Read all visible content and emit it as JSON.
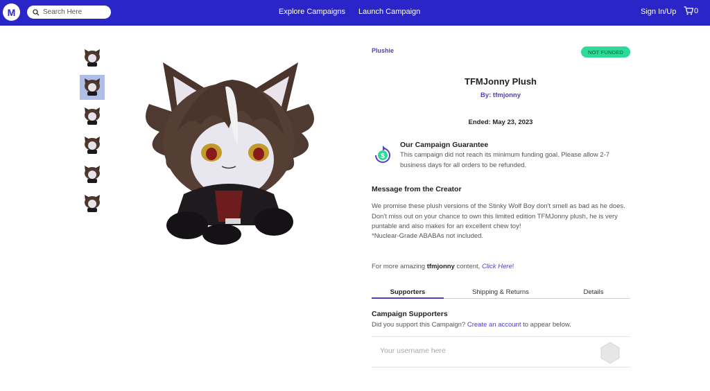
{
  "nav": {
    "logo_letter": "M",
    "search_placeholder": "Search Here",
    "explore": "Explore Campaigns",
    "launch": "Launch Campaign",
    "signin": "Sign In/Up",
    "cart_count": "0"
  },
  "product": {
    "category": "Plushie",
    "status": "NOT FUNDED",
    "title": "TFMJonny Plush",
    "by": "By: tfmjonny",
    "ended": "Ended: May 23, 2023"
  },
  "guarantee": {
    "title": "Our Campaign Guarantee",
    "text": "This campaign did not reach its minimum funding goal. Please allow 2-7 business days for all orders to be refunded."
  },
  "message": {
    "heading": "Message from the Creator",
    "body": "We promise these plush versions of the Stinky Wolf Boy don't smell as bad as he does. Don't miss out on your chance to own this limited edition TFMJonny plush, he is very puntable and also makes for an excellent chew toy!",
    "note": "*Nuclear-Grade ABABAs not included."
  },
  "more": {
    "prefix": "For more amazing ",
    "creator": "tfmjonny",
    "middle": " content, ",
    "link": "Click Here",
    "suffix": "!"
  },
  "tabs": [
    "Supporters",
    "Shipping & Returns",
    "Details"
  ],
  "supporters": {
    "heading": "Campaign Supporters",
    "text_prefix": "Did you support this Campaign? ",
    "link": "Create an account",
    "text_suffix": " to appear below.",
    "input_placeholder": "Your username here"
  },
  "colors": {
    "brand": "#2a25c9",
    "accent": "#4b3fc4",
    "status_green": "#2fd998"
  },
  "thumbnails": 6,
  "active_thumbnail": 2
}
